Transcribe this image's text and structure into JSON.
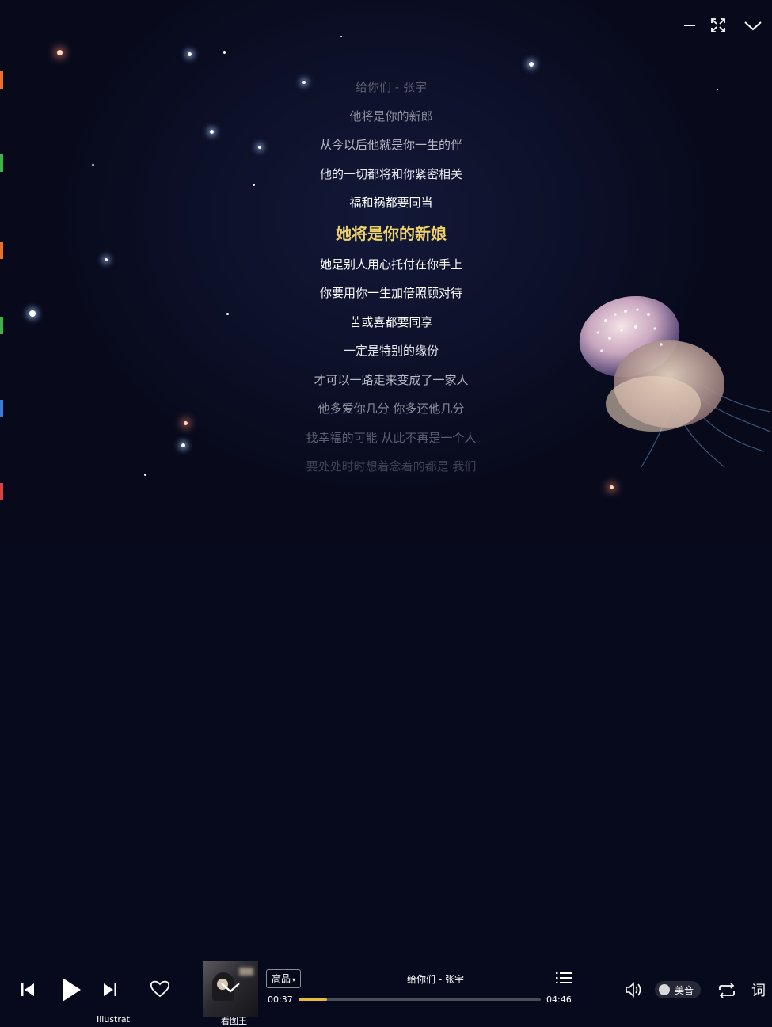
{
  "window_controls": [
    "minimize-icon",
    "fullscreen-icon",
    "collapse-icon"
  ],
  "lyrics": {
    "lines": [
      {
        "text": "给你们 - 张宇",
        "color": "#5b5d70"
      },
      {
        "text": "他将是你的新郎",
        "color": "#8a8c9c"
      },
      {
        "text": "从今以后他就是你一生的伴",
        "color": "#b8bac6"
      },
      {
        "text": "他的一切都将和你紧密相关",
        "color": "#e8e9ee"
      },
      {
        "text": "福和祸都要同当",
        "color": "#ffffff"
      }
    ],
    "current": {
      "text": "她将是你的新娘",
      "color": "#f0d26a"
    },
    "after": [
      {
        "text": "她是别人用心托付在你手上",
        "color": "#ffffff"
      },
      {
        "text": "你要用你一生加倍照顾对待",
        "color": "#ffffff"
      },
      {
        "text": "苦或喜都要同享",
        "color": "#ffffff"
      },
      {
        "text": "一定是特别的缘份",
        "color": "#e8e9ee"
      },
      {
        "text": "才可以一路走来变成了一家人",
        "color": "#b8bac6"
      },
      {
        "text": "他多爱你几分 你多还他几分",
        "color": "#8a8c9c"
      },
      {
        "text": "找幸福的可能 从此不再是一个人",
        "color": "#5b5d70"
      },
      {
        "text": "要处处时时想着念着的都是 我们",
        "color": "#3f4154"
      }
    ]
  },
  "player": {
    "quality_label": "高品",
    "song_title": "给你们 - 张宇",
    "elapsed": "00:37",
    "duration": "04:46",
    "progress_fraction": 0.118,
    "meiyin_label": "美音",
    "lyrics_button_label": "词",
    "accent_color": "#e8b93a"
  },
  "desktop_labels": [
    "Illustrat",
    "看图王"
  ]
}
